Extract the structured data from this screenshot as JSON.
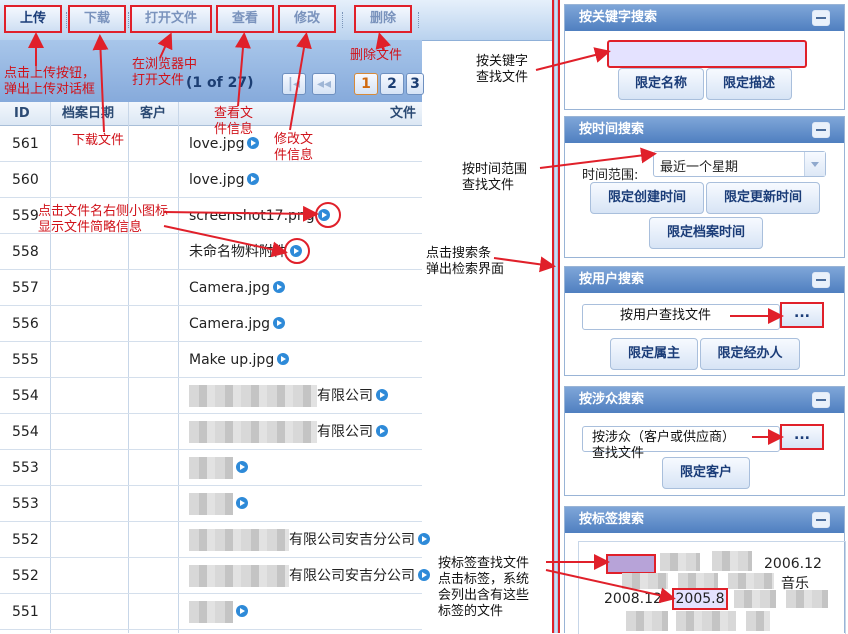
{
  "toolbar": {
    "upload": "上传",
    "download": "下载",
    "open_file": "打开文件",
    "view": "查看",
    "edit": "修改",
    "delete": "删除"
  },
  "pager": {
    "info": "(1 of 27)",
    "pages": [
      "1",
      "2",
      "3"
    ]
  },
  "grid": {
    "columns": [
      "ID",
      "档案日期",
      "客户",
      "文件"
    ],
    "rows": [
      {
        "id": "561",
        "file": "love.jpg"
      },
      {
        "id": "560",
        "file": "love.jpg"
      },
      {
        "id": "559",
        "file": "screenshot17.png"
      },
      {
        "id": "558",
        "file": "未命名物料附件"
      },
      {
        "id": "557",
        "file": "Camera.jpg"
      },
      {
        "id": "556",
        "file": "Camera.jpg"
      },
      {
        "id": "555",
        "file": "Make up.jpg"
      },
      {
        "id": "554",
        "file": "有限公司"
      },
      {
        "id": "554",
        "file": "有限公司"
      },
      {
        "id": "553",
        "file": ""
      },
      {
        "id": "553",
        "file": ""
      },
      {
        "id": "552",
        "file": "有限公司安吉分公司"
      },
      {
        "id": "552",
        "file": "有限公司安吉分公司"
      },
      {
        "id": "551",
        "file": ""
      }
    ]
  },
  "panels": {
    "keyword": {
      "title": "按关键字搜索",
      "btn_name": "限定名称",
      "btn_desc": "限定描述"
    },
    "time": {
      "title": "按时间搜索",
      "range_label": "时间范围:",
      "range_value": "最近一个星期",
      "btn_created": "限定创建时间",
      "btn_updated": "限定更新时间",
      "btn_archive": "限定档案时间"
    },
    "user": {
      "title": "按用户搜索",
      "dots": "...",
      "btn_owner": "限定属主",
      "btn_handler": "限定经办人"
    },
    "party": {
      "title": "按涉众搜索",
      "dots": "...",
      "btn_client": "限定客户"
    },
    "tags": {
      "title": "按标签搜索",
      "tag1": "2006.12",
      "tag2": "音乐",
      "tag3": "2008.12",
      "tag4": "2005.8"
    }
  },
  "annotations": {
    "upload": [
      "点击上传按钮，",
      "弹出上传对话框"
    ],
    "download": "下载文件",
    "open_file": [
      "在浏览器中",
      "打开文件"
    ],
    "view": [
      "查看文",
      "件信息"
    ],
    "edit": [
      "修改文",
      "件信息"
    ],
    "delete": "删除文件",
    "file_icon": [
      "点击文件名右侧小图标",
      "显示文件简略信息"
    ],
    "keyword": [
      "按关键字",
      "查找文件"
    ],
    "time": [
      "按时间范围",
      "查找文件"
    ],
    "splitter": [
      "点击搜索条",
      "弹出检索界面"
    ],
    "user": "按用户查找文件",
    "party": [
      "按涉众（客户或供应商）",
      "查找文件"
    ],
    "tags": [
      "按标签查找文件",
      "点击标签，系统",
      "会列出含有这些",
      "标签的文件"
    ]
  },
  "colors": {
    "annotation": "#e0202a",
    "panel_header": "#4f7fc0",
    "toolbar": "#cfdff3"
  }
}
